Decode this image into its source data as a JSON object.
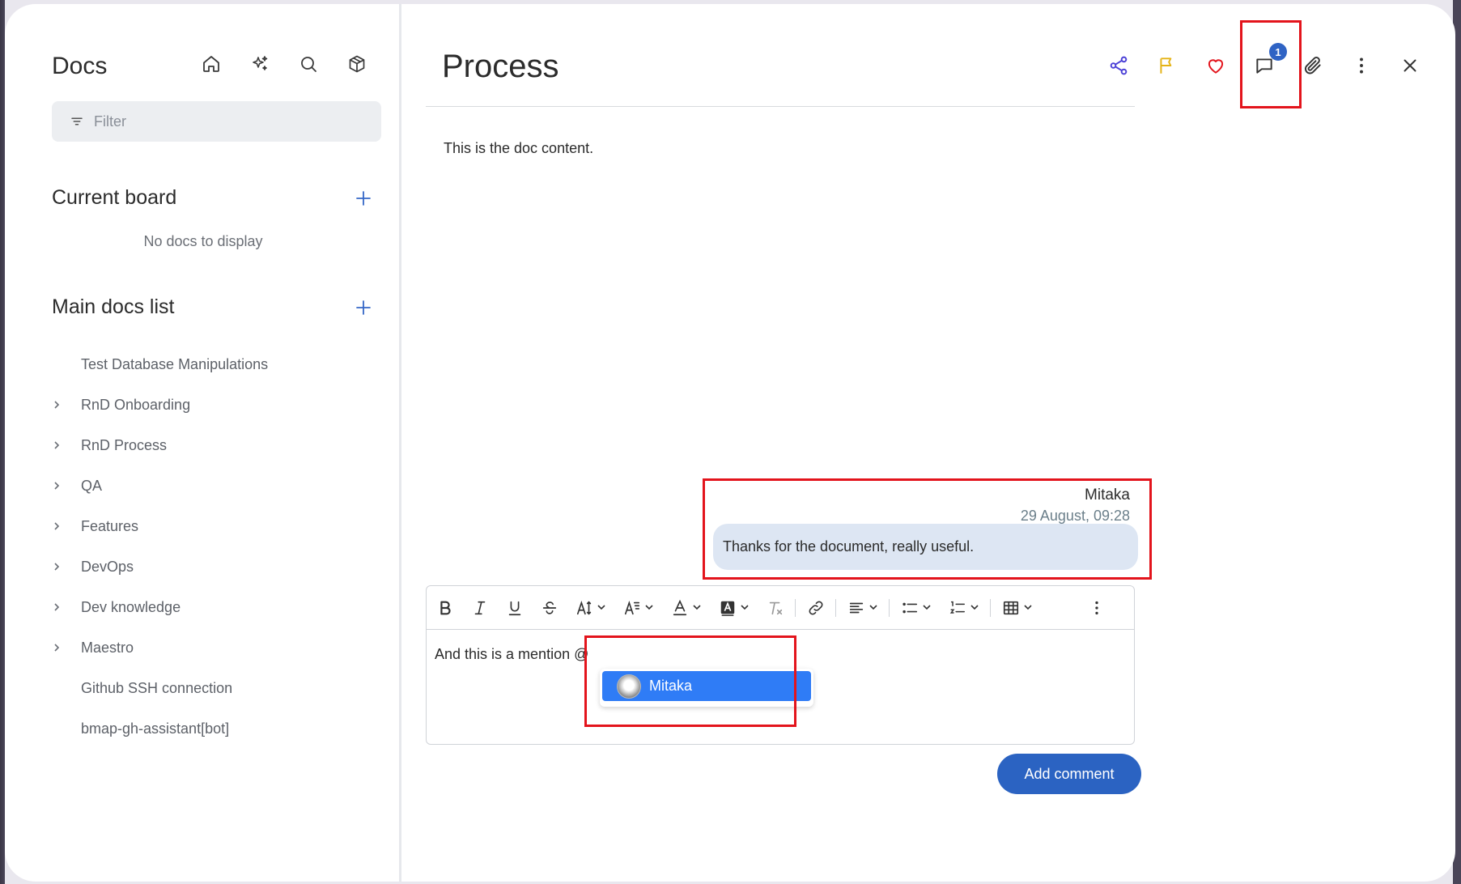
{
  "sidebar": {
    "title": "Docs",
    "filter_placeholder": "Filter",
    "current_board": {
      "title": "Current board",
      "empty_text": "No docs to display"
    },
    "main_docs": {
      "title": "Main docs list",
      "items": [
        {
          "label": "Test Database Manipulations",
          "expandable": false
        },
        {
          "label": "RnD Onboarding",
          "expandable": true
        },
        {
          "label": "RnD Process",
          "expandable": true
        },
        {
          "label": "QA",
          "expandable": true
        },
        {
          "label": "Features",
          "expandable": true
        },
        {
          "label": "DevOps",
          "expandable": true
        },
        {
          "label": "Dev knowledge",
          "expandable": true
        },
        {
          "label": "Maestro",
          "expandable": true
        },
        {
          "label": "Github SSH connection",
          "expandable": false
        },
        {
          "label": "bmap-gh-assistant[bot]",
          "expandable": false
        }
      ]
    },
    "icons": [
      "home-icon",
      "sparkles-icon",
      "search-icon",
      "package-icon"
    ]
  },
  "document": {
    "title": "Process",
    "content": "This is the doc content.",
    "comment_count": "1"
  },
  "comment": {
    "author": "Mitaka",
    "timestamp": "29 August, 09:28",
    "text": "Thanks for the document, really useful."
  },
  "editor": {
    "text": "And this is a mention @",
    "mention_suggestion": "Mitaka",
    "submit_label": "Add comment"
  },
  "colors": {
    "accent": "#2b63c2",
    "share_icon": "#4a3fd6",
    "flag_icon": "#e5b316",
    "heart_icon": "#e3141c",
    "highlight": "#e3141c",
    "mention_highlight": "#2f7cf6"
  }
}
